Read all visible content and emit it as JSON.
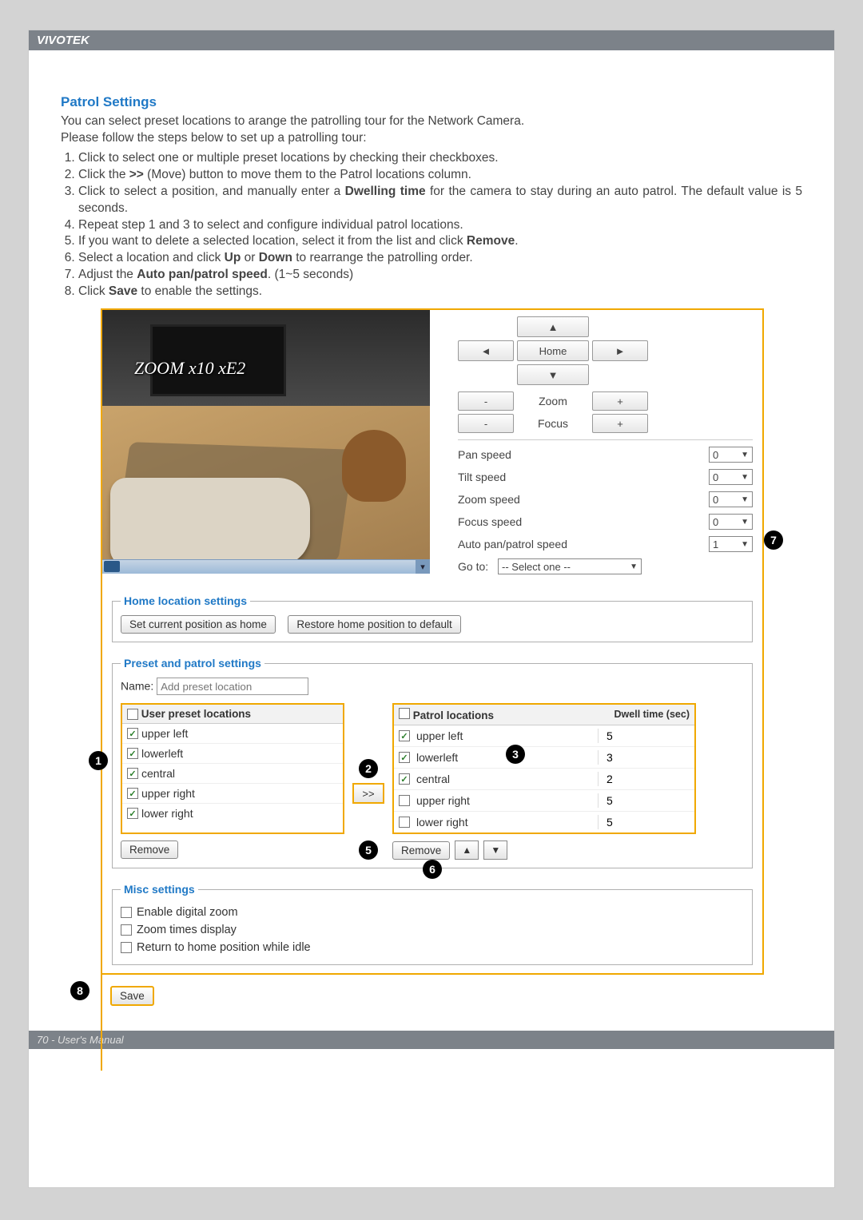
{
  "brand": "VIVOTEK",
  "section_title": "Patrol Settings",
  "intro1": "You can select preset locations to arange the patrolling tour for the Network Camera.",
  "intro2": "Please follow the steps below to set up a patrolling tour:",
  "steps": [
    "Click to select one or multiple preset locations by checking their checkboxes.",
    "Click the >> (Move) button to move them to the Patrol locations column.",
    "Click to select a position, and manually enter a Dwelling time for the camera to stay during an auto patrol. The default value is 5 seconds.",
    "Repeat step 1 and 3 to select and configure individual patrol locations.",
    "If you want to delete a selected location, select it from the list and click Remove.",
    "Select a location and click Up or Down to rearrange the patrolling order.",
    "Adjust the Auto pan/patrol speed. (1~5 seconds)",
    "Click Save to enable the settings."
  ],
  "preview_overlay": "ZOOM x10 xE2",
  "dir": {
    "up": "▲",
    "down": "▼",
    "left": "◄",
    "right": "►",
    "home": "Home"
  },
  "zf": {
    "minus": "-",
    "plus": "+",
    "zoom": "Zoom",
    "focus": "Focus"
  },
  "speeds": [
    {
      "label": "Pan speed",
      "value": "0"
    },
    {
      "label": "Tilt speed",
      "value": "0"
    },
    {
      "label": "Zoom speed",
      "value": "0"
    },
    {
      "label": "Focus speed",
      "value": "0"
    },
    {
      "label": "Auto pan/patrol speed",
      "value": "1"
    }
  ],
  "goto_label": "Go to:",
  "goto_value": "-- Select one --",
  "fieldsets": {
    "home": {
      "legend": "Home location settings",
      "btn1": "Set current position as home",
      "btn2": "Restore home position to default"
    },
    "preset": {
      "legend": "Preset and patrol settings",
      "name_label": "Name:",
      "name_placeholder": "Add preset location",
      "user_header": "User preset locations",
      "patrol_header": "Patrol locations",
      "dwell_header": "Dwell time (sec)",
      "move_btn": ">>",
      "remove": "Remove",
      "up": "▲",
      "down": "▼",
      "user_list": [
        {
          "name": "upper left",
          "checked": true
        },
        {
          "name": "lowerleft",
          "checked": true
        },
        {
          "name": "central",
          "checked": true
        },
        {
          "name": "upper right",
          "checked": true
        },
        {
          "name": "lower right",
          "checked": true
        }
      ],
      "patrol_list": [
        {
          "name": "upper left",
          "checked": true,
          "dwell": "5"
        },
        {
          "name": "lowerleft",
          "checked": true,
          "dwell": "3"
        },
        {
          "name": "central",
          "checked": true,
          "dwell": "2"
        },
        {
          "name": "upper right",
          "checked": false,
          "dwell": "5"
        },
        {
          "name": "lower right",
          "checked": false,
          "dwell": "5"
        }
      ]
    },
    "misc": {
      "legend": "Misc settings",
      "opt1": "Enable digital zoom",
      "opt2": "Zoom times display",
      "opt3": "Return to home position while idle"
    }
  },
  "save": "Save",
  "footer": "70 - User's Manual",
  "badges": {
    "1": "1",
    "2": "2",
    "3": "3",
    "5": "5",
    "6": "6",
    "7": "7",
    "8": "8"
  }
}
